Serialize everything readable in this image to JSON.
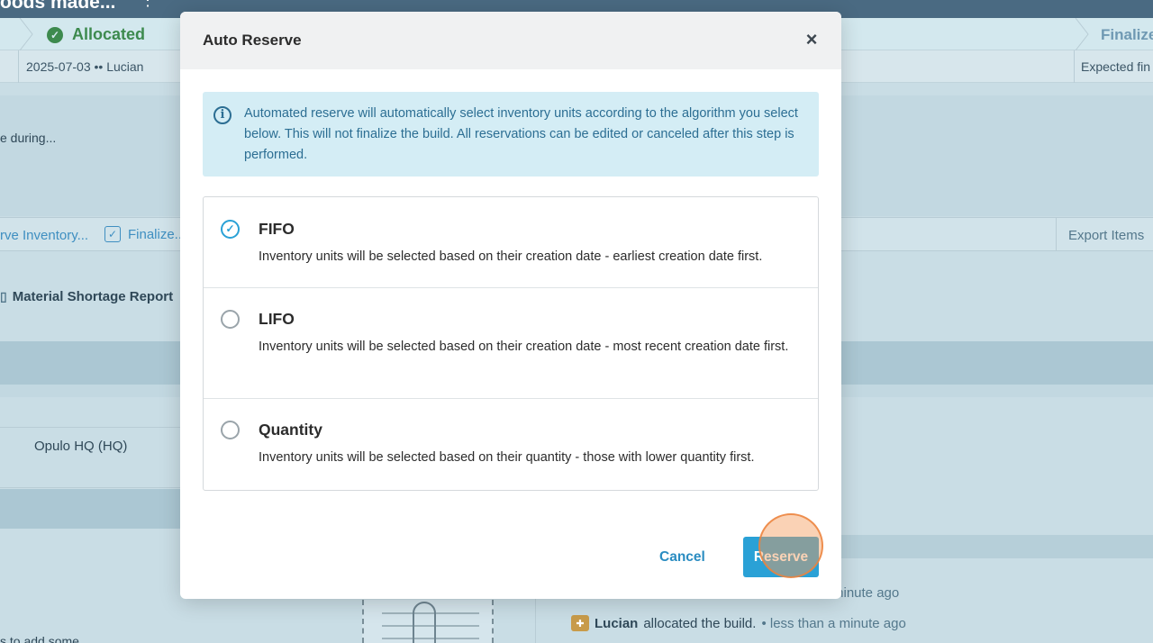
{
  "background": {
    "window_title": "oods made...",
    "kebab": "⋮",
    "steps": {
      "allocated": "Allocated",
      "finalize": "Finalize"
    },
    "meta": {
      "date_user": "2025-07-03 •• Lucian",
      "expected": "Expected fin"
    },
    "during_text": "e during...",
    "toolbar": {
      "reserve_inventory": "rve Inventory...",
      "finalize": "Finalize...",
      "export_items": "Export Items"
    },
    "material_shortage": "Material Shortage Report",
    "location": "Opulo HQ (HQ)",
    "activity": {
      "minute_ago": "minute ago",
      "user": "Lucian",
      "action": "allocated the build.",
      "time": "• less than a minute ago"
    },
    "bottom_hint": "s to add some"
  },
  "modal": {
    "title": "Auto Reserve",
    "close": "×",
    "info": "Automated reserve will automatically select inventory units according to the algorithm you select below. This will not finalize the build. All reservations can be edited or canceled after this step is performed.",
    "options": [
      {
        "name": "FIFO",
        "description": "Inventory units will be selected based on their creation date - earliest creation date first.",
        "selected": true
      },
      {
        "name": "LIFO",
        "description": "Inventory units will be selected based on their creation date - most recent creation date first.",
        "selected": false
      },
      {
        "name": "Quantity",
        "description": "Inventory units will be selected based on their quantity - those with lower quantity first.",
        "selected": false
      }
    ],
    "cancel_label": "Cancel",
    "reserve_label": "Reserve"
  },
  "colors": {
    "accent": "#2aa1d6",
    "info_bg": "#d4edf5",
    "info_text": "#2c6e93",
    "success": "#3d8a4e"
  }
}
